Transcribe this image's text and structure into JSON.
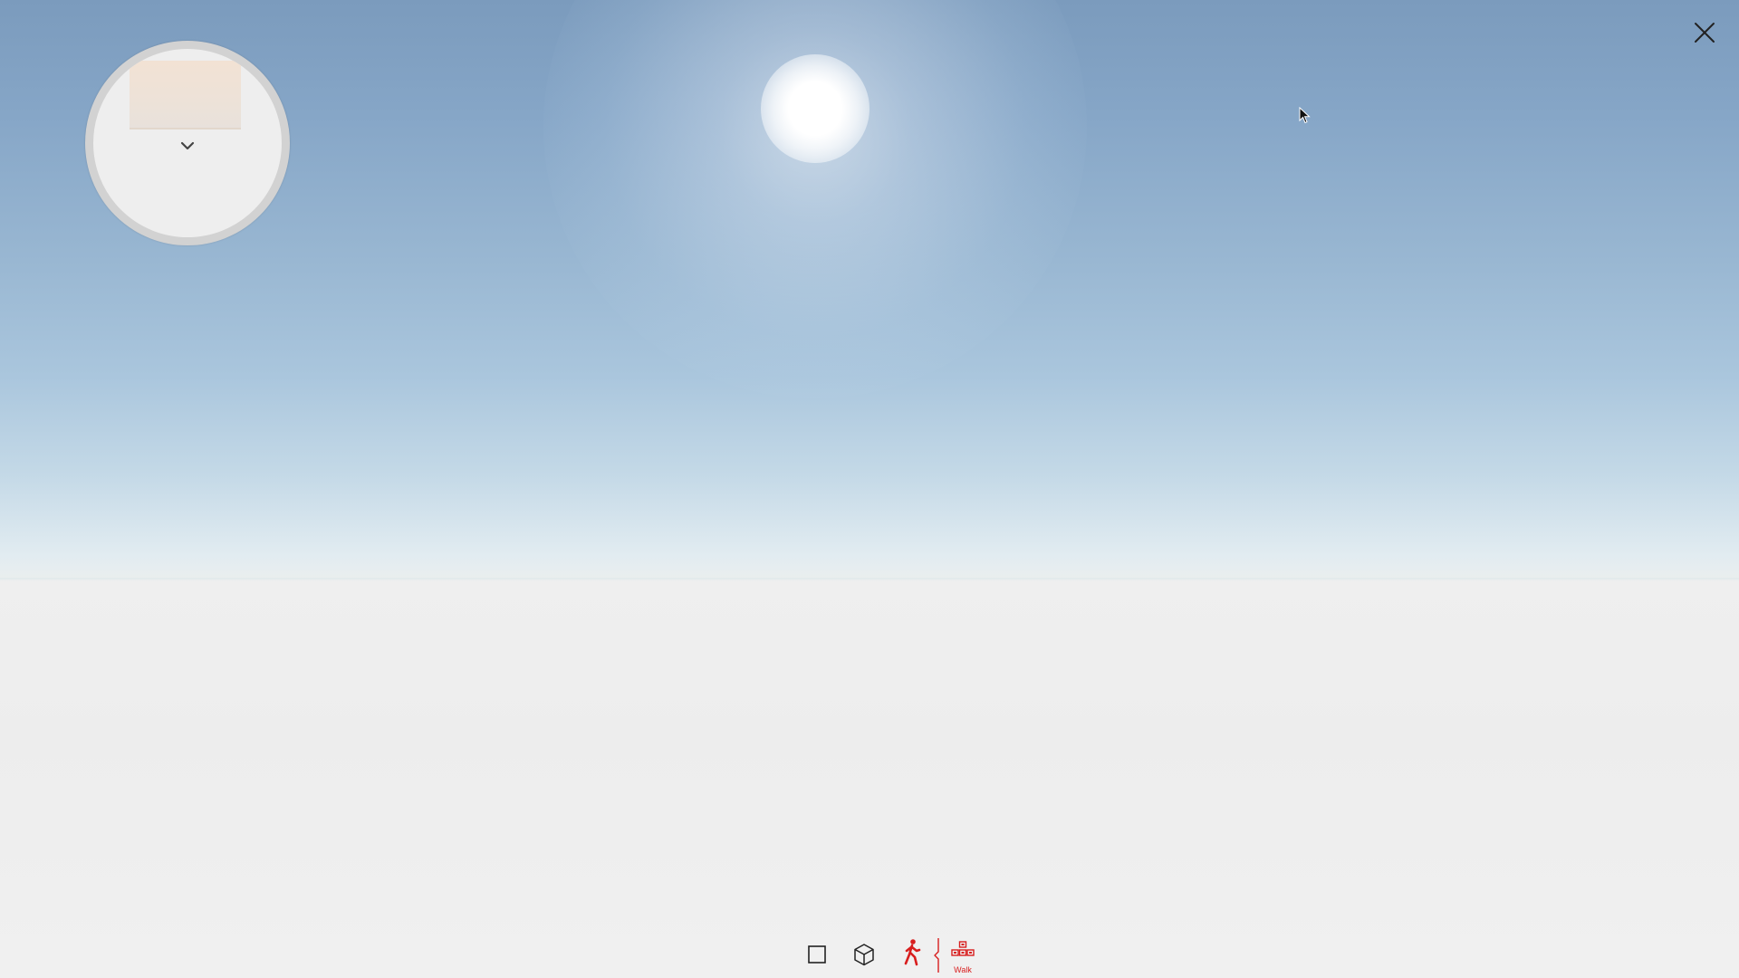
{
  "scene": {
    "sky_top_color": "#7b9bbd",
    "horizon_color": "#e2ecf1",
    "ground_color": "#efefef"
  },
  "camera_widget": {
    "preview_color": "#f2e2d4",
    "expand_icon": "chevron-down-icon"
  },
  "window": {
    "close_icon": "close-icon"
  },
  "toolbar": {
    "accent_color": "#d81e1e",
    "tools": [
      {
        "id": "2d-view",
        "icon": "square-icon"
      },
      {
        "id": "3d-view",
        "icon": "cube-icon"
      },
      {
        "id": "walk-mode",
        "icon": "walking-person-icon",
        "active": true
      },
      {
        "id": "walk-controls",
        "icon": "keyboard-keys-icon",
        "label": "Walk"
      }
    ]
  }
}
